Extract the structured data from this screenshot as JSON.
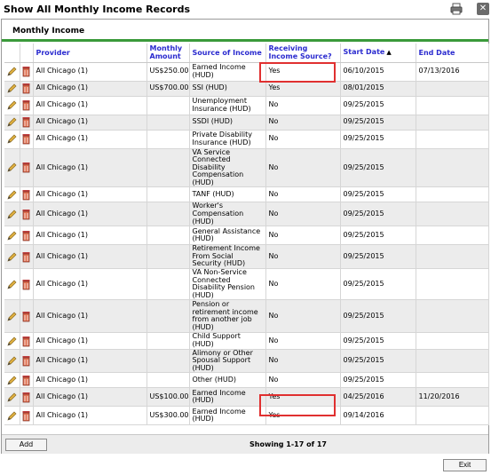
{
  "window": {
    "title": "Show All Monthly Income Records"
  },
  "tab": {
    "label": "Monthly Income"
  },
  "table": {
    "columns": [
      "Provider",
      "Monthly Amount",
      "Source of Income",
      "Receiving Income Source?",
      "Start Date",
      "End Date"
    ],
    "rows": [
      [
        "All Chicago (1)",
        "US$250.00",
        "Earned Income (HUD)",
        "Yes",
        "06/10/2015",
        "07/13/2016"
      ],
      [
        "All Chicago (1)",
        "US$700.00",
        "SSI (HUD)",
        "Yes",
        "08/01/2015",
        ""
      ],
      [
        "All Chicago (1)",
        "",
        "Unemployment Insurance (HUD)",
        "No",
        "09/25/2015",
        ""
      ],
      [
        "All Chicago (1)",
        "",
        "SSDI (HUD)",
        "No",
        "09/25/2015",
        ""
      ],
      [
        "All Chicago (1)",
        "",
        "Private Disability Insurance (HUD)",
        "No",
        "09/25/2015",
        ""
      ],
      [
        "All Chicago (1)",
        "",
        "VA Service Connected Disability Compensation (HUD)",
        "No",
        "09/25/2015",
        ""
      ],
      [
        "All Chicago (1)",
        "",
        "TANF (HUD)",
        "No",
        "09/25/2015",
        ""
      ],
      [
        "All Chicago (1)",
        "",
        "Worker's Compensation (HUD)",
        "No",
        "09/25/2015",
        ""
      ],
      [
        "All Chicago (1)",
        "",
        "General Assistance (HUD)",
        "No",
        "09/25/2015",
        ""
      ],
      [
        "All Chicago (1)",
        "",
        "Retirement Income From Social Security (HUD)",
        "No",
        "09/25/2015",
        ""
      ],
      [
        "All Chicago (1)",
        "",
        "VA Non-Service Connected Disability Pension (HUD)",
        "No",
        "09/25/2015",
        ""
      ],
      [
        "All Chicago (1)",
        "",
        "Pension or retirement income from another job (HUD)",
        "No",
        "09/25/2015",
        ""
      ],
      [
        "All Chicago (1)",
        "",
        "Child Support (HUD)",
        "No",
        "09/25/2015",
        ""
      ],
      [
        "All Chicago (1)",
        "",
        "Alimony or Other Spousal Support (HUD)",
        "No",
        "09/25/2015",
        ""
      ],
      [
        "All Chicago (1)",
        "",
        "Other (HUD)",
        "No",
        "09/25/2015",
        ""
      ],
      [
        "All Chicago (1)",
        "US$100.00",
        "Earned Income (HUD)",
        "Yes",
        "04/25/2016",
        "11/20/2016"
      ],
      [
        "All Chicago (1)",
        "US$300.00",
        "Earned Income (HUD)",
        "Yes",
        "09/14/2016",
        ""
      ]
    ]
  },
  "footer": {
    "add_label": "Add",
    "showing_text": "Showing 1-17 of 17"
  },
  "exit_label": "Exit",
  "icons": {
    "edit": "pencil-icon",
    "delete": "trash-icon",
    "print": "printer-icon",
    "close": "close-icon"
  },
  "colors": {
    "header_text": "#2b2bcf",
    "tab_underline": "#3a9a3a",
    "highlight_box": "#e03030"
  }
}
